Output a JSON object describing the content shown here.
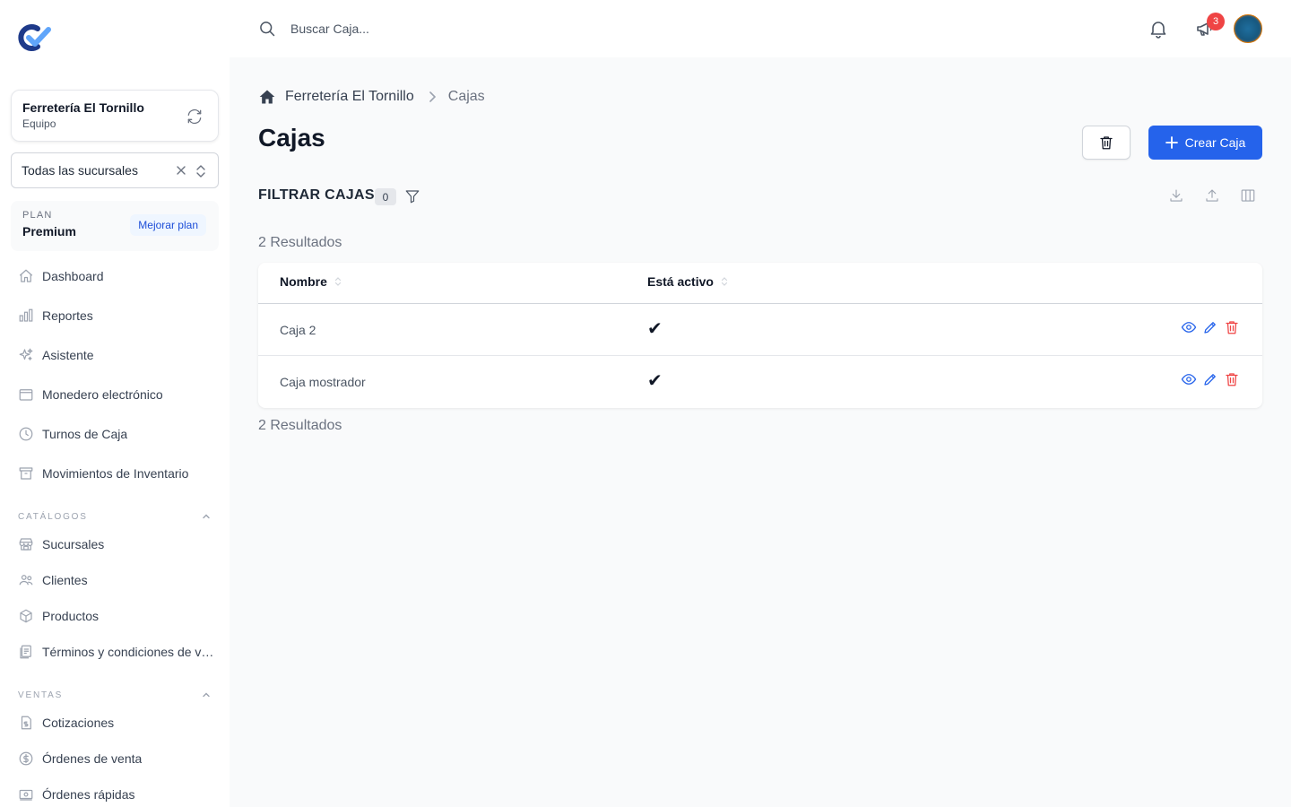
{
  "brand": {
    "logo_icon": "brand-logo-icon",
    "primary": "#2563eb",
    "accent": "#1d4ed8"
  },
  "team": {
    "name": "Ferretería El Tornillo",
    "role": "Equipo"
  },
  "branch_select": {
    "value": "Todas las sucursales"
  },
  "plan": {
    "label": "PLAN",
    "name": "Premium",
    "upgrade_label": "Mejorar plan"
  },
  "nav": {
    "main": [
      {
        "label": "Dashboard",
        "icon": "home-icon"
      },
      {
        "label": "Reportes",
        "icon": "chart-icon"
      },
      {
        "label": "Asistente",
        "icon": "sparkles-icon"
      },
      {
        "label": "Monedero electrónico",
        "icon": "wallet-icon"
      },
      {
        "label": "Turnos de Caja",
        "icon": "clock-icon"
      },
      {
        "label": "Movimientos de Inventario",
        "icon": "archive-icon"
      }
    ],
    "catalogos": {
      "title": "CATÁLOGOS",
      "items": [
        {
          "label": "Sucursales",
          "icon": "store-icon"
        },
        {
          "label": "Clientes",
          "icon": "users-icon"
        },
        {
          "label": "Productos",
          "icon": "cube-icon"
        },
        {
          "label": "Términos y condiciones de venta",
          "icon": "document-icon"
        }
      ]
    },
    "ventas": {
      "title": "VENTAS",
      "items": [
        {
          "label": "Cotizaciones",
          "icon": "invoice-icon"
        },
        {
          "label": "Órdenes de venta",
          "icon": "dollar-icon"
        },
        {
          "label": "Órdenes rápidas",
          "icon": "cash-icon"
        }
      ]
    }
  },
  "topbar": {
    "search_placeholder": "Buscar Caja...",
    "announcement_badge": "3"
  },
  "breadcrumb": {
    "root": "Ferretería El Tornillo",
    "current": "Cajas"
  },
  "page": {
    "title": "Cajas",
    "create_label": "Crear Caja",
    "filter_title": "FILTRAR CAJAS",
    "filter_count": "0",
    "results_top": "2 Resultados",
    "results_bottom": "2 Resultados"
  },
  "table": {
    "columns": [
      "Nombre",
      "Está activo"
    ],
    "rows": [
      {
        "name": "Caja 2",
        "active": "✔"
      },
      {
        "name": "Caja mostrador",
        "active": "✔"
      }
    ]
  }
}
